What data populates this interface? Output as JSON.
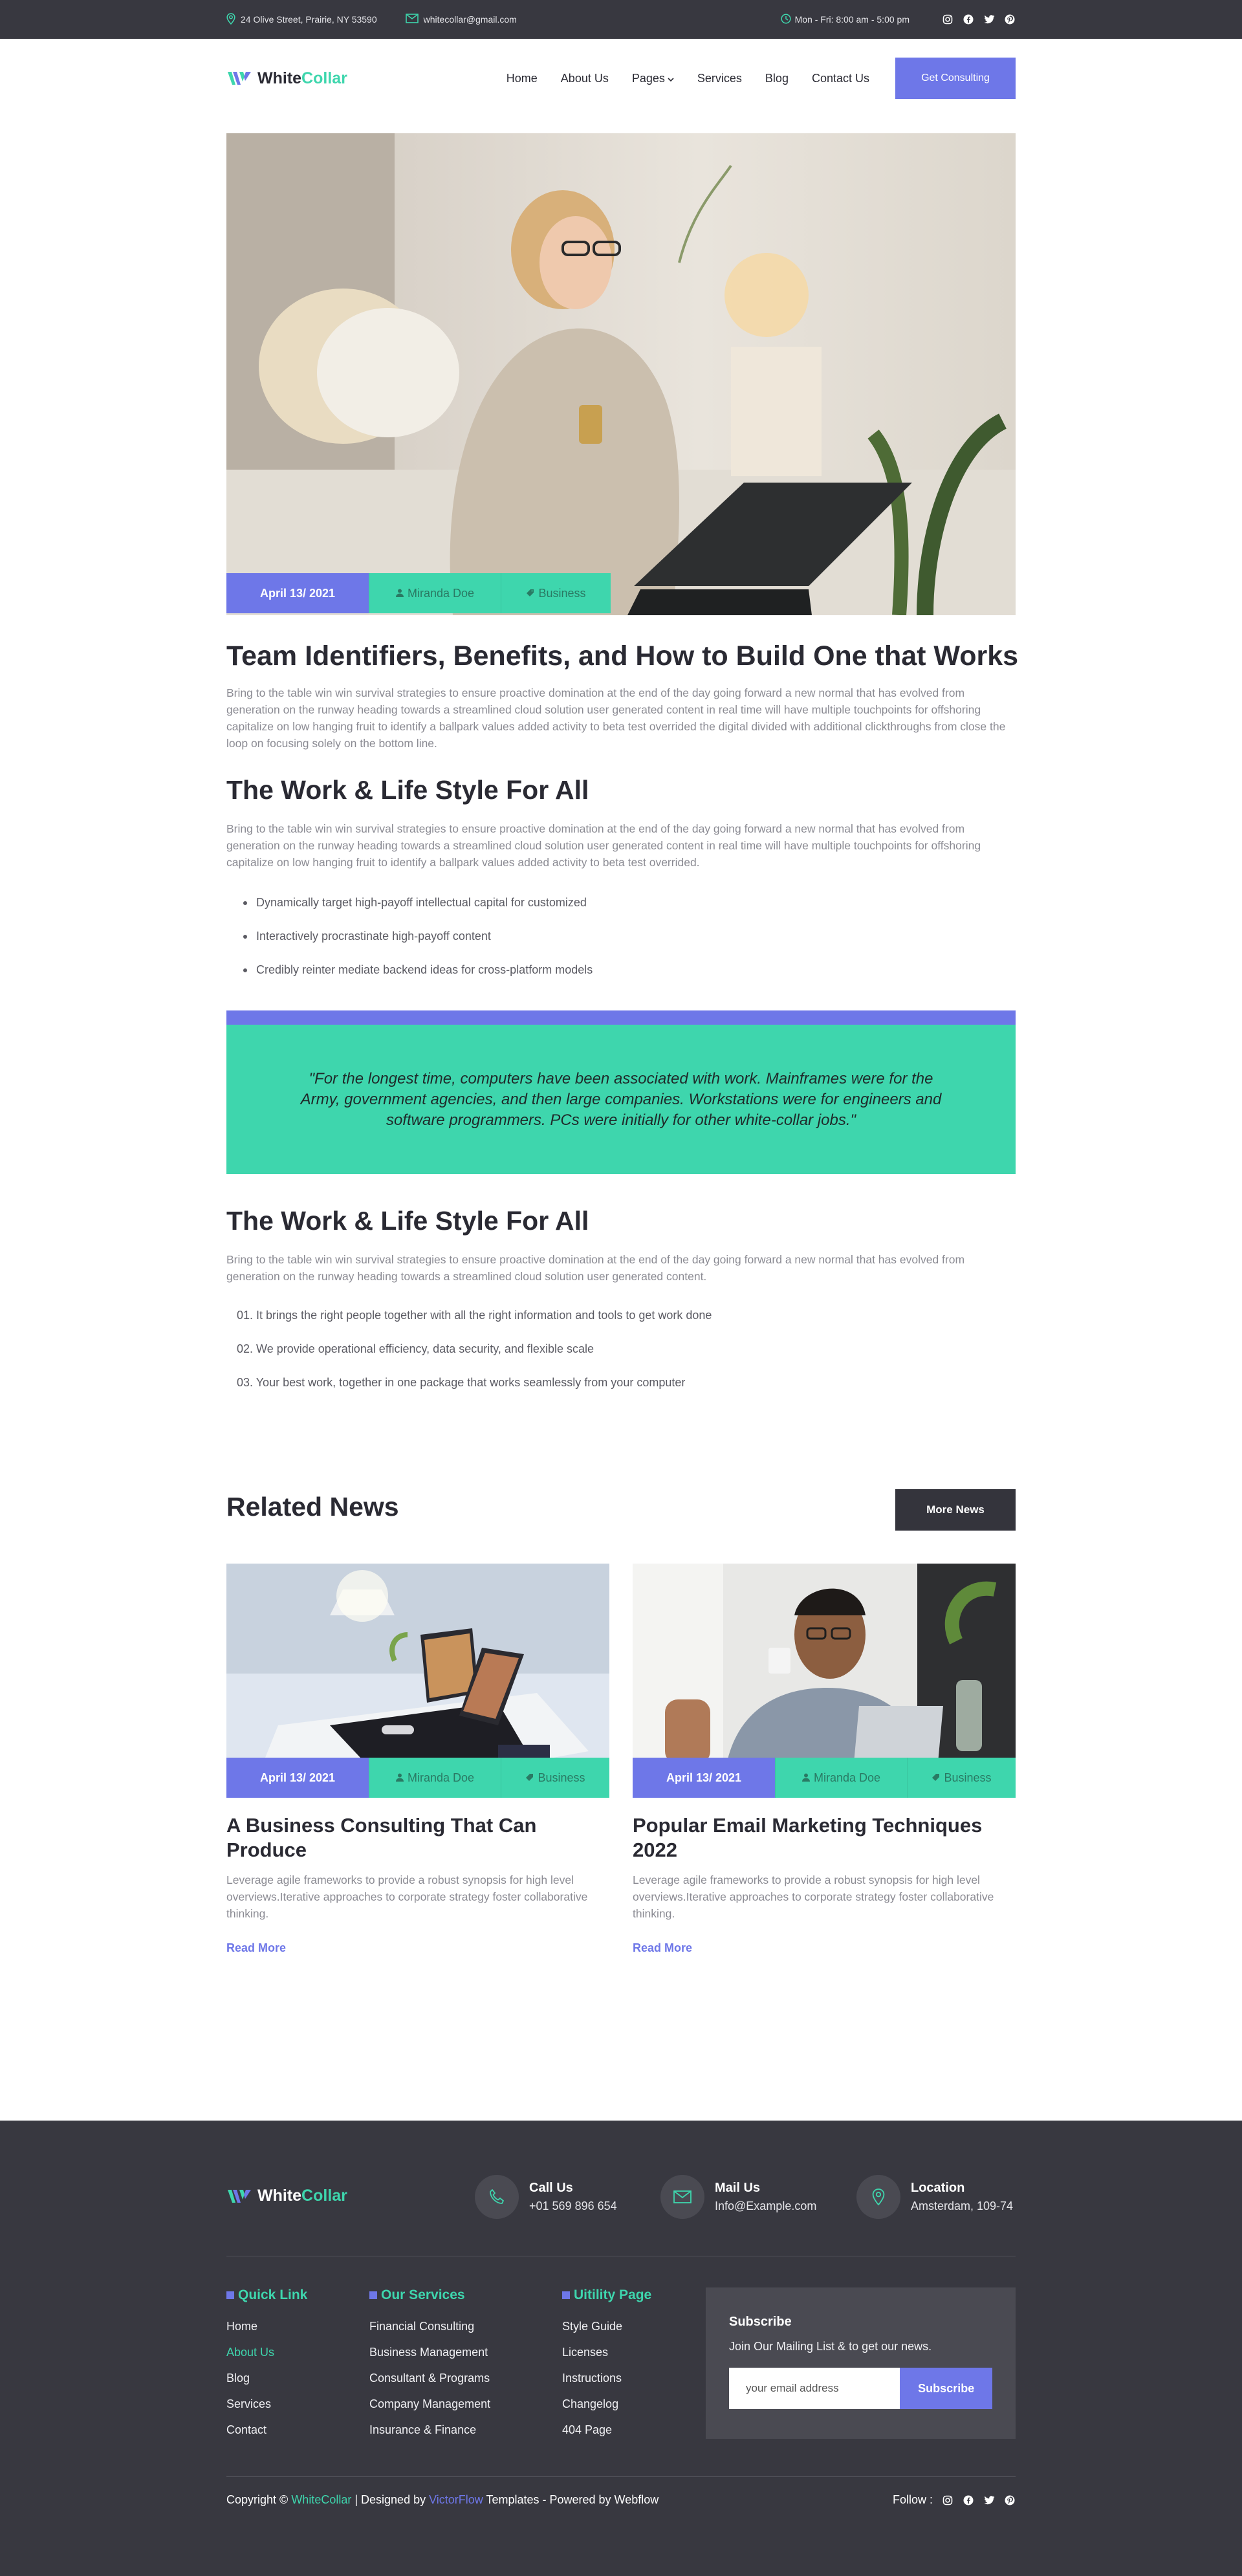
{
  "topbar": {
    "address": "24 Olive Street, Prairie, NY 53590",
    "email": "whitecollar@gmail.com",
    "hours": "Mon - Fri: 8:00 am - 5:00 pm"
  },
  "brand": {
    "name_a": "White",
    "name_b": "Collar",
    "accent": "#3ed6ad",
    "primary": "#6e77e8",
    "dark": "#383840"
  },
  "nav": {
    "items": [
      "Home",
      "About Us",
      "Pages",
      "Services",
      "Blog",
      "Contact Us"
    ],
    "cta": "Get Consulting"
  },
  "post": {
    "date": "April 13/ 2021",
    "author": "Miranda Doe",
    "category": "Business",
    "title": "Team Identifiers, Benefits, and How to Build One that Works",
    "intro": "Bring to the table win win survival strategies to ensure proactive domination at the end of the day going forward a new normal that has evolved from generation on the runway heading towards a streamlined cloud solution user generated content in real time will have multiple  touchpoints for offshoring capitalize on low hanging fruit to identify a ballpark values added activity to beta test overrided the digital divided with additional clickthroughs from close the loop on focusing solely on the bottom line.",
    "section1_title": "The Work & Life Style For All",
    "section1_text": "Bring to the table win win survival strategies to ensure proactive domination at the end of the day going forward a new normal that has evolved from generation on the runway heading towards a streamlined cloud solution user generated content in real time will have multiple  touchpoints for offshoring capitalize on low hanging fruit to identify a ballpark values added activity to beta test overrided.",
    "bullets": [
      "Dynamically target high-payoff intellectual capital for customized",
      "Interactively procrastinate high-payoff content",
      "Credibly reinter mediate backend ideas for cross-platform models"
    ],
    "quote": "\"For the longest time, computers have been associated with work. Mainframes were for the Army, government agencies, and then large companies. Workstations were for engineers and software programmers. PCs were initially for other white-collar jobs.\"",
    "section2_title": "The Work & Life Style For All",
    "section2_text": "Bring to the table win win survival strategies to ensure proactive domination at the end of the day going forward a new normal that has evolved from generation on the runway heading towards a streamlined cloud solution user generated content.",
    "numbered": [
      "01. It brings the right people together with all the right information and tools to get work done",
      "02.  We provide operational efficiency, data security, and flexible scale",
      "03. Your best work, together in one package that works seamlessly from your computer"
    ]
  },
  "related": {
    "title": "Related News",
    "more": "More News",
    "cards": [
      {
        "date": "April 13/ 2021",
        "author": "Miranda Doe",
        "category": "Business",
        "title": "A Business Consulting That Can Produce",
        "text": "Leverage agile frameworks to provide a robust synopsis for high level overviews.Iterative approaches to corporate strategy foster collaborative thinking.",
        "link": "Read More"
      },
      {
        "date": "April 13/ 2021",
        "author": "Miranda Doe",
        "category": "Business",
        "title": "Popular Email Marketing Techniques 2022",
        "text": "Leverage agile frameworks to provide a robust synopsis for high level overviews.Iterative approaches to corporate strategy foster collaborative thinking.",
        "link": "Read More"
      }
    ]
  },
  "footer": {
    "call": {
      "label": "Call Us",
      "value": "+01 569 896 654"
    },
    "mail": {
      "label": "Mail Us",
      "value": "Info@Example.com"
    },
    "location": {
      "label": "Location",
      "value": "Amsterdam, 109-74"
    },
    "quick": {
      "title": "Quick Link",
      "links": [
        "Home",
        "About Us",
        "Blog",
        "Services",
        "Contact"
      ]
    },
    "services": {
      "title": "Our Services",
      "links": [
        "Financial Consulting",
        "Business Management",
        "Consultant & Programs",
        "Company Management",
        "Insurance & Finance"
      ]
    },
    "utility": {
      "title": "Uitility Page",
      "links": [
        "Style Guide",
        "Licenses",
        "Instructions",
        "Changelog",
        "404 Page"
      ]
    },
    "subscribe": {
      "title": "Subscribe",
      "text": "Join Our Mailing List & to get our news.",
      "placeholder": "your email address",
      "button": "Subscribe"
    },
    "copyright": {
      "a": "Copyright © ",
      "brand": "WhiteCollar",
      "b": " | Designed by ",
      "designer": "VictorFlow",
      "c": " Templates - Powered by Webflow"
    },
    "follow": "Follow :"
  }
}
